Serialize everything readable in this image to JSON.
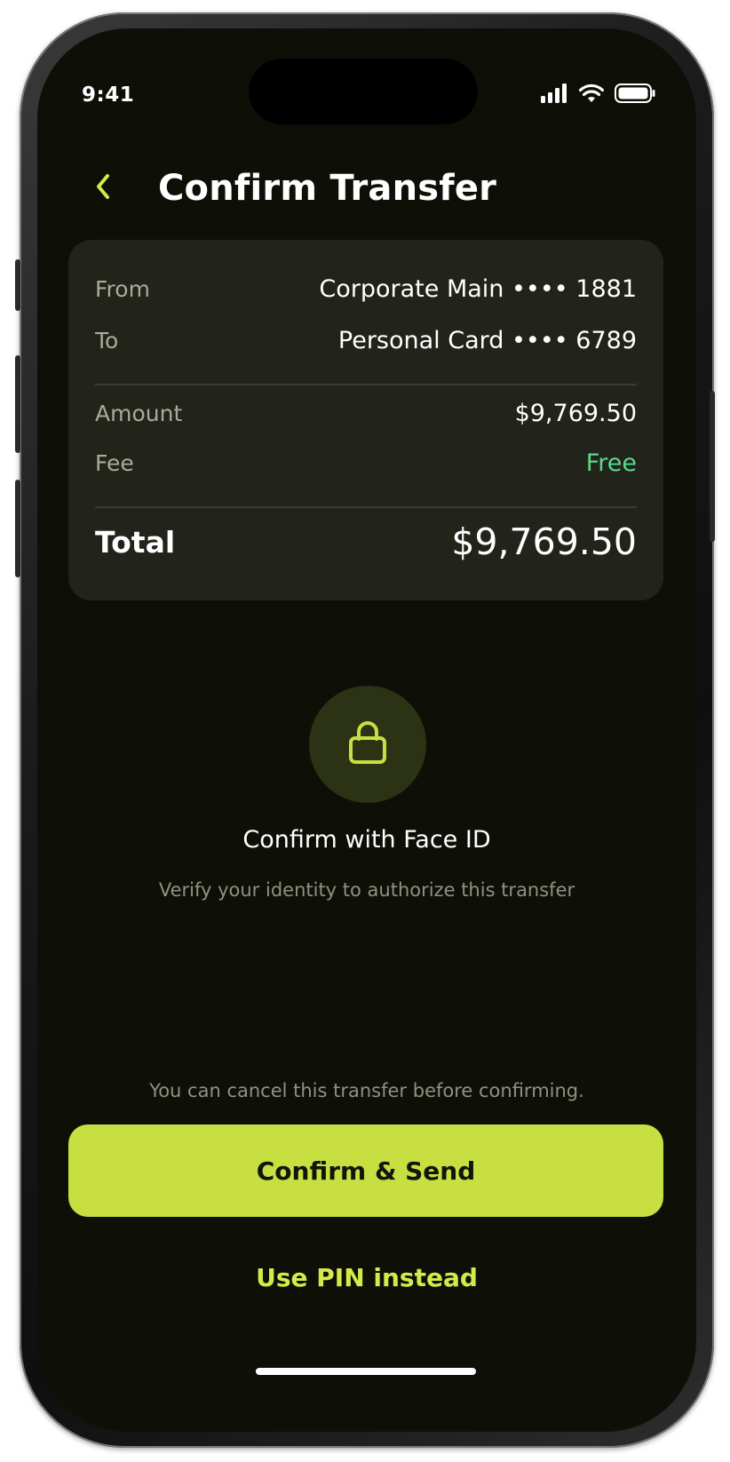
{
  "status_bar": {
    "time": "9:41",
    "icons": [
      "cellular-signal-icon",
      "wifi-icon",
      "battery-icon"
    ]
  },
  "header": {
    "back_icon": "chevron-left-icon",
    "title": "Confirm Transfer"
  },
  "summary": {
    "from_label": "From",
    "from_value": "Corporate Main •••• 1881",
    "to_label": "To",
    "to_value": "Personal Card •••• 6789",
    "amount_label": "Amount",
    "amount_value": "$9,769.50",
    "fee_label": "Fee",
    "fee_value": "Free",
    "total_label": "Total",
    "total_value": "$9,769.50"
  },
  "face_id": {
    "icon": "lock-icon",
    "title": "Confirm with Face ID",
    "subtitle": "Verify your identity to authorize this transfer"
  },
  "footer": {
    "cancel_note": "You can cancel this transfer before confirming.",
    "confirm_label": "Confirm & Send",
    "pin_label": "Use PIN instead"
  },
  "colors": {
    "background": "#0e1008",
    "card": "#22241b",
    "accent": "#c8df42",
    "fee_green": "#57d98a",
    "muted_text": "#8f9182"
  }
}
